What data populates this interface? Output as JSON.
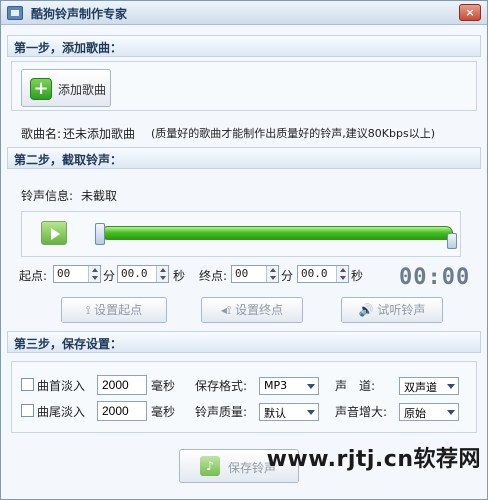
{
  "window": {
    "title": "酷狗铃声制作专家",
    "close_label": "×"
  },
  "step1": {
    "header": "第一步，添加歌曲：",
    "add_button_label": "添加歌曲",
    "add_icon": "plus-icon",
    "song_name_label": "歌曲名:",
    "song_name_value": "还未添加歌曲",
    "hint": "(质量好的歌曲才能制作出质量好的铃声,建议80Kbps以上)"
  },
  "step2": {
    "header": "第二步，截取铃声：",
    "info_label": "铃声信息:",
    "info_value": "未截取",
    "start_label": "起点:",
    "start_min": "00",
    "start_sec": "00.0",
    "end_label": "终点:",
    "end_min": "00",
    "end_sec": "00.0",
    "min_unit": "分",
    "sec_unit": "秒",
    "time_display": "00:00",
    "set_start_label": "设置起点",
    "set_end_label": "设置终点",
    "preview_label": "试听铃声"
  },
  "step3": {
    "header": "第三步，保存设置：",
    "fade_in_label": "曲首淡入",
    "fade_in_value": "2000",
    "fade_out_label": "曲尾淡入",
    "fade_out_value": "2000",
    "ms_unit": "毫秒",
    "format_label": "保存格式:",
    "format_value": "MP3",
    "quality_label": "铃声质量:",
    "quality_value": "默认",
    "channel_label": "声　道:",
    "channel_value": "双声道",
    "boost_label": "声音增大:",
    "boost_value": "原始",
    "save_label": "保存铃声"
  },
  "watermark": "www.rjtj.cn软荐网"
}
